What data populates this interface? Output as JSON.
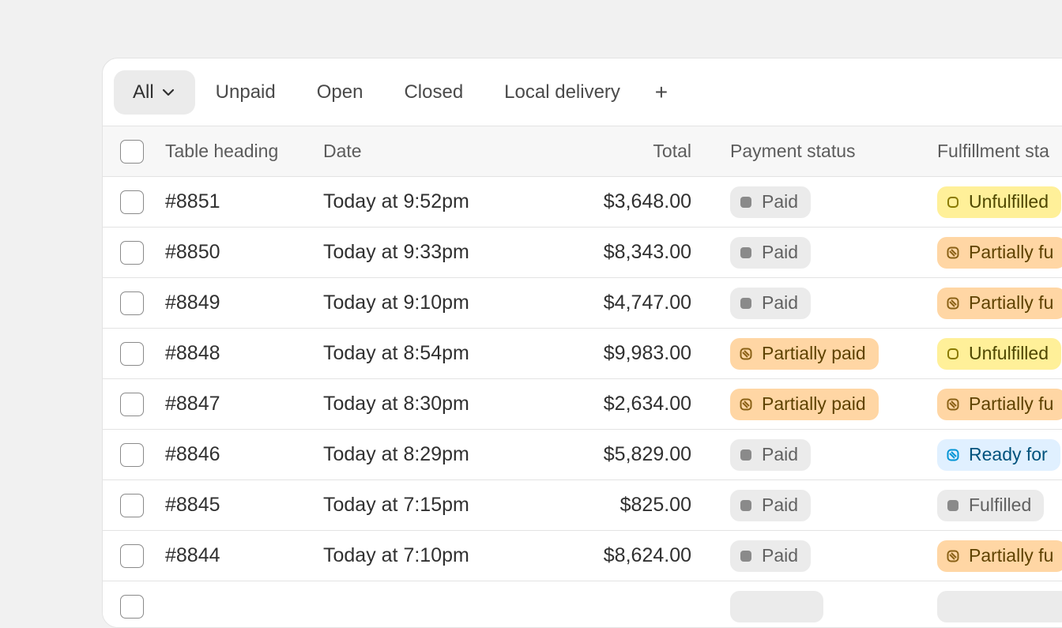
{
  "tabs": [
    {
      "label": "All",
      "selected": true
    },
    {
      "label": "Unpaid",
      "selected": false
    },
    {
      "label": "Open",
      "selected": false
    },
    {
      "label": "Closed",
      "selected": false
    },
    {
      "label": "Local delivery",
      "selected": false
    }
  ],
  "add_tab_label": "+",
  "table": {
    "headers": {
      "order": "Table heading",
      "date": "Date",
      "total": "Total",
      "payment": "Payment status",
      "fulfillment": "Fulfillment sta"
    },
    "rows": [
      {
        "order": "#8851",
        "date": "Today at 9:52pm",
        "total": "$3,648.00",
        "payment": "Paid",
        "fulfillment": "Unfulfilled"
      },
      {
        "order": "#8850",
        "date": "Today at 9:33pm",
        "total": "$8,343.00",
        "payment": "Paid",
        "fulfillment": "Partially fu"
      },
      {
        "order": "#8849",
        "date": "Today at 9:10pm",
        "total": "$4,747.00",
        "payment": "Paid",
        "fulfillment": "Partially fu"
      },
      {
        "order": "#8848",
        "date": "Today at 8:54pm",
        "total": "$9,983.00",
        "payment": "Partially paid",
        "fulfillment": "Unfulfilled"
      },
      {
        "order": "#8847",
        "date": "Today at 8:30pm",
        "total": "$2,634.00",
        "payment": "Partially paid",
        "fulfillment": "Partially fu"
      },
      {
        "order": "#8846",
        "date": "Today at 8:29pm",
        "total": "$5,829.00",
        "payment": "Paid",
        "fulfillment": "Ready for"
      },
      {
        "order": "#8845",
        "date": "Today at 7:15pm",
        "total": "$825.00",
        "payment": "Paid",
        "fulfillment": "Fulfilled"
      },
      {
        "order": "#8844",
        "date": "Today at 7:10pm",
        "total": "$8,624.00",
        "payment": "Paid",
        "fulfillment": "Partially fu"
      }
    ]
  },
  "icons": {
    "tab_dropdown": "chevron-down-icon",
    "paid": "dot-icon",
    "partial": "partial-striped-icon",
    "unfulfilled": "incomplete-circle-icon",
    "ready": "ready-striped-icon"
  },
  "colors": {
    "paid_bg": "#ebebeb",
    "partial_bg": "#ffd6a4",
    "unfulfilled_bg": "#fff099",
    "ready_bg": "#e0f0ff"
  }
}
